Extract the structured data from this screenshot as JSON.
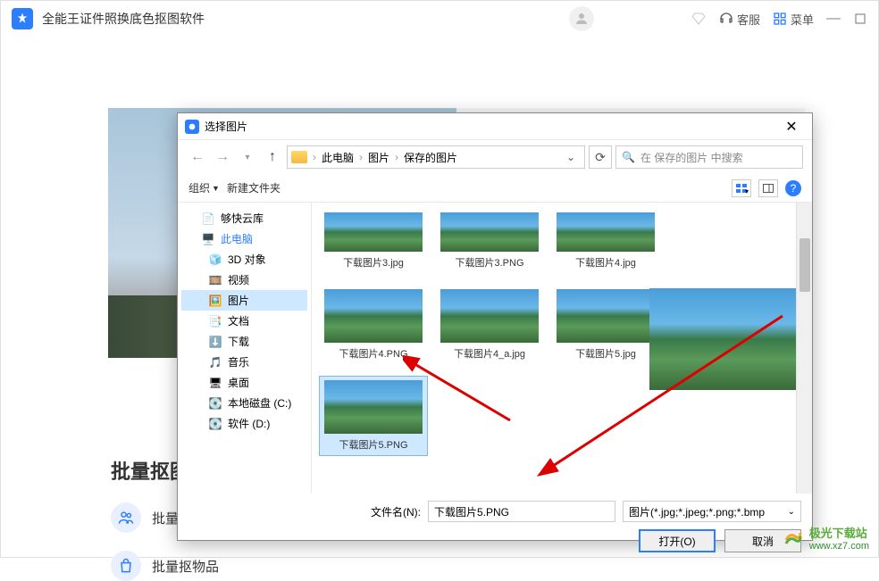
{
  "app": {
    "title": "全能王证件照换底色抠图软件",
    "user_name": "",
    "service": "客服",
    "menu": "菜单"
  },
  "background": {
    "section_title": "批量抠图",
    "features": [
      "批量",
      "批量抠物品"
    ]
  },
  "dialog": {
    "title": "选择图片",
    "breadcrumb": [
      "此电脑",
      "图片",
      "保存的图片"
    ],
    "search_placeholder": "在 保存的图片 中搜索",
    "toolbar": {
      "organize": "组织",
      "new_folder": "新建文件夹"
    },
    "sidebar": [
      {
        "label": "够快云库",
        "icon": "doc",
        "indent": 1
      },
      {
        "label": "此电脑",
        "icon": "pc",
        "indent": 1,
        "bold": true
      },
      {
        "label": "3D 对象",
        "icon": "3d",
        "indent": 2
      },
      {
        "label": "视频",
        "icon": "video",
        "indent": 2
      },
      {
        "label": "图片",
        "icon": "pic",
        "indent": 2,
        "selected": true
      },
      {
        "label": "文档",
        "icon": "docs",
        "indent": 2
      },
      {
        "label": "下载",
        "icon": "dl",
        "indent": 2
      },
      {
        "label": "音乐",
        "icon": "music",
        "indent": 2
      },
      {
        "label": "桌面",
        "icon": "desk",
        "indent": 2
      },
      {
        "label": "本地磁盘 (C:)",
        "icon": "disk",
        "indent": 2
      },
      {
        "label": "软件 (D:)",
        "icon": "disk",
        "indent": 2
      }
    ],
    "files_row1": [
      {
        "label": "下载图片3.jpg"
      },
      {
        "label": "下载图片3.PNG"
      },
      {
        "label": "下载图片4.jpg"
      }
    ],
    "files_row2": [
      {
        "label": "下载图片4.PNG"
      },
      {
        "label": "下载图片4_a.jpg"
      },
      {
        "label": "下载图片5.jpg"
      }
    ],
    "files_row3": [
      {
        "label": "下载图片5.PNG",
        "selected": true
      }
    ],
    "filename_label": "文件名(N):",
    "filename_value": "下载图片5.PNG",
    "filter": "图片(*.jpg;*.jpeg;*.png;*.bmp",
    "open_btn": "打开(O)",
    "cancel_btn": "取消"
  },
  "watermark": {
    "name": "极光下载站",
    "url": "www.xz7.com"
  }
}
